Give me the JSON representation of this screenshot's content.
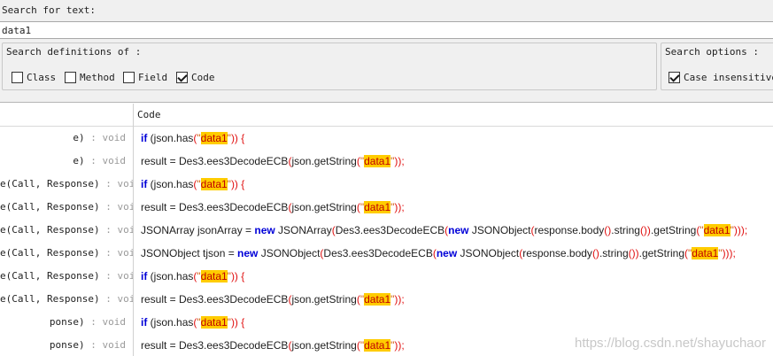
{
  "search": {
    "label": "Search for text:",
    "value": "data1"
  },
  "definitions": {
    "title": "Search definitions of :",
    "options": [
      {
        "label": "Class",
        "checked": false
      },
      {
        "label": "Method",
        "checked": false
      },
      {
        "label": "Field",
        "checked": false
      },
      {
        "label": "Code",
        "checked": true
      }
    ]
  },
  "search_options": {
    "title": "Search options :",
    "case_insensitive": {
      "label": "Case insensitive",
      "checked": true
    }
  },
  "results": {
    "code_header": "Code",
    "rows": [
      {
        "left_name": "e)",
        "left_type": " : void",
        "code": [
          {
            "t": "if",
            "c": "kw"
          },
          {
            "t": " (json.has"
          },
          {
            "t": "(",
            "c": "pn"
          },
          {
            "t": "\"",
            "c": "qt"
          },
          {
            "t": "data1",
            "c": "hl"
          },
          {
            "t": "\"",
            "c": "qt"
          },
          {
            "t": ")) {",
            "c": "pn"
          }
        ]
      },
      {
        "left_name": "e)",
        "left_type": " : void",
        "code": [
          {
            "t": "result = Des3.ees3DecodeECB"
          },
          {
            "t": "(",
            "c": "pn"
          },
          {
            "t": "json.getString"
          },
          {
            "t": "(",
            "c": "pn"
          },
          {
            "t": "\"",
            "c": "qt"
          },
          {
            "t": "data1",
            "c": "hl"
          },
          {
            "t": "\"",
            "c": "qt"
          },
          {
            "t": "));",
            "c": "pn"
          }
        ]
      },
      {
        "left_name": "e(Call, Response)",
        "left_type": " : void",
        "code": [
          {
            "t": "if",
            "c": "kw"
          },
          {
            "t": " (json.has"
          },
          {
            "t": "(",
            "c": "pn"
          },
          {
            "t": "\"",
            "c": "qt"
          },
          {
            "t": "data1",
            "c": "hl"
          },
          {
            "t": "\"",
            "c": "qt"
          },
          {
            "t": ")) {",
            "c": "pn"
          }
        ]
      },
      {
        "left_name": "e(Call, Response)",
        "left_type": " : void",
        "code": [
          {
            "t": "result = Des3.ees3DecodeECB"
          },
          {
            "t": "(",
            "c": "pn"
          },
          {
            "t": "json.getString"
          },
          {
            "t": "(",
            "c": "pn"
          },
          {
            "t": "\"",
            "c": "qt"
          },
          {
            "t": "data1",
            "c": "hl"
          },
          {
            "t": "\"",
            "c": "qt"
          },
          {
            "t": "));",
            "c": "pn"
          }
        ]
      },
      {
        "left_name": "e(Call, Response)",
        "left_type": " : void",
        "code": [
          {
            "t": "JSONArray jsonArray = "
          },
          {
            "t": "new",
            "c": "kw"
          },
          {
            "t": " JSONArray"
          },
          {
            "t": "(",
            "c": "pn"
          },
          {
            "t": "Des3.ees3DecodeECB"
          },
          {
            "t": "(",
            "c": "pn"
          },
          {
            "t": "new",
            "c": "kw"
          },
          {
            "t": " JSONObject"
          },
          {
            "t": "(",
            "c": "pn"
          },
          {
            "t": "response.body"
          },
          {
            "t": "()",
            "c": "pn"
          },
          {
            "t": ".string"
          },
          {
            "t": "())",
            "c": "pn"
          },
          {
            "t": ".getString"
          },
          {
            "t": "(",
            "c": "pn"
          },
          {
            "t": "\"",
            "c": "qt"
          },
          {
            "t": "data1",
            "c": "hl"
          },
          {
            "t": "\"",
            "c": "qt"
          },
          {
            "t": ")));",
            "c": "pn"
          }
        ]
      },
      {
        "left_name": "e(Call, Response)",
        "left_type": " : void",
        "code": [
          {
            "t": "JSONObject tjson = "
          },
          {
            "t": "new",
            "c": "kw"
          },
          {
            "t": " JSONObject"
          },
          {
            "t": "(",
            "c": "pn"
          },
          {
            "t": "Des3.ees3DecodeECB"
          },
          {
            "t": "(",
            "c": "pn"
          },
          {
            "t": "new",
            "c": "kw"
          },
          {
            "t": " JSONObject"
          },
          {
            "t": "(",
            "c": "pn"
          },
          {
            "t": "response.body"
          },
          {
            "t": "()",
            "c": "pn"
          },
          {
            "t": ".string"
          },
          {
            "t": "())",
            "c": "pn"
          },
          {
            "t": ".getString"
          },
          {
            "t": "(",
            "c": "pn"
          },
          {
            "t": "\"",
            "c": "qt"
          },
          {
            "t": "data1",
            "c": "hl"
          },
          {
            "t": "\"",
            "c": "qt"
          },
          {
            "t": ")));",
            "c": "pn"
          }
        ]
      },
      {
        "left_name": "e(Call, Response)",
        "left_type": " : void",
        "code": [
          {
            "t": "if",
            "c": "kw"
          },
          {
            "t": " (json.has"
          },
          {
            "t": "(",
            "c": "pn"
          },
          {
            "t": "\"",
            "c": "qt"
          },
          {
            "t": "data1",
            "c": "hl"
          },
          {
            "t": "\"",
            "c": "qt"
          },
          {
            "t": ")) {",
            "c": "pn"
          }
        ]
      },
      {
        "left_name": "e(Call, Response)",
        "left_type": " : void",
        "code": [
          {
            "t": "result = Des3.ees3DecodeECB"
          },
          {
            "t": "(",
            "c": "pn"
          },
          {
            "t": "json.getString"
          },
          {
            "t": "(",
            "c": "pn"
          },
          {
            "t": "\"",
            "c": "qt"
          },
          {
            "t": "data1",
            "c": "hl"
          },
          {
            "t": "\"",
            "c": "qt"
          },
          {
            "t": "));",
            "c": "pn"
          }
        ]
      },
      {
        "left_name": "ponse)",
        "left_type": " : void",
        "code": [
          {
            "t": "if",
            "c": "kw"
          },
          {
            "t": " (json.has"
          },
          {
            "t": "(",
            "c": "pn"
          },
          {
            "t": "\"",
            "c": "qt"
          },
          {
            "t": "data1",
            "c": "hl"
          },
          {
            "t": "\"",
            "c": "qt"
          },
          {
            "t": ")) {",
            "c": "pn"
          }
        ]
      },
      {
        "left_name": "ponse)",
        "left_type": " : void",
        "code": [
          {
            "t": "result = Des3.ees3DecodeECB"
          },
          {
            "t": "(",
            "c": "pn"
          },
          {
            "t": "json.getString"
          },
          {
            "t": "(",
            "c": "pn"
          },
          {
            "t": "\"",
            "c": "qt"
          },
          {
            "t": "data1",
            "c": "hl"
          },
          {
            "t": "\"",
            "c": "qt"
          },
          {
            "t": "));",
            "c": "pn"
          }
        ]
      }
    ]
  },
  "watermark": "https://blog.csdn.net/shayuchaor"
}
